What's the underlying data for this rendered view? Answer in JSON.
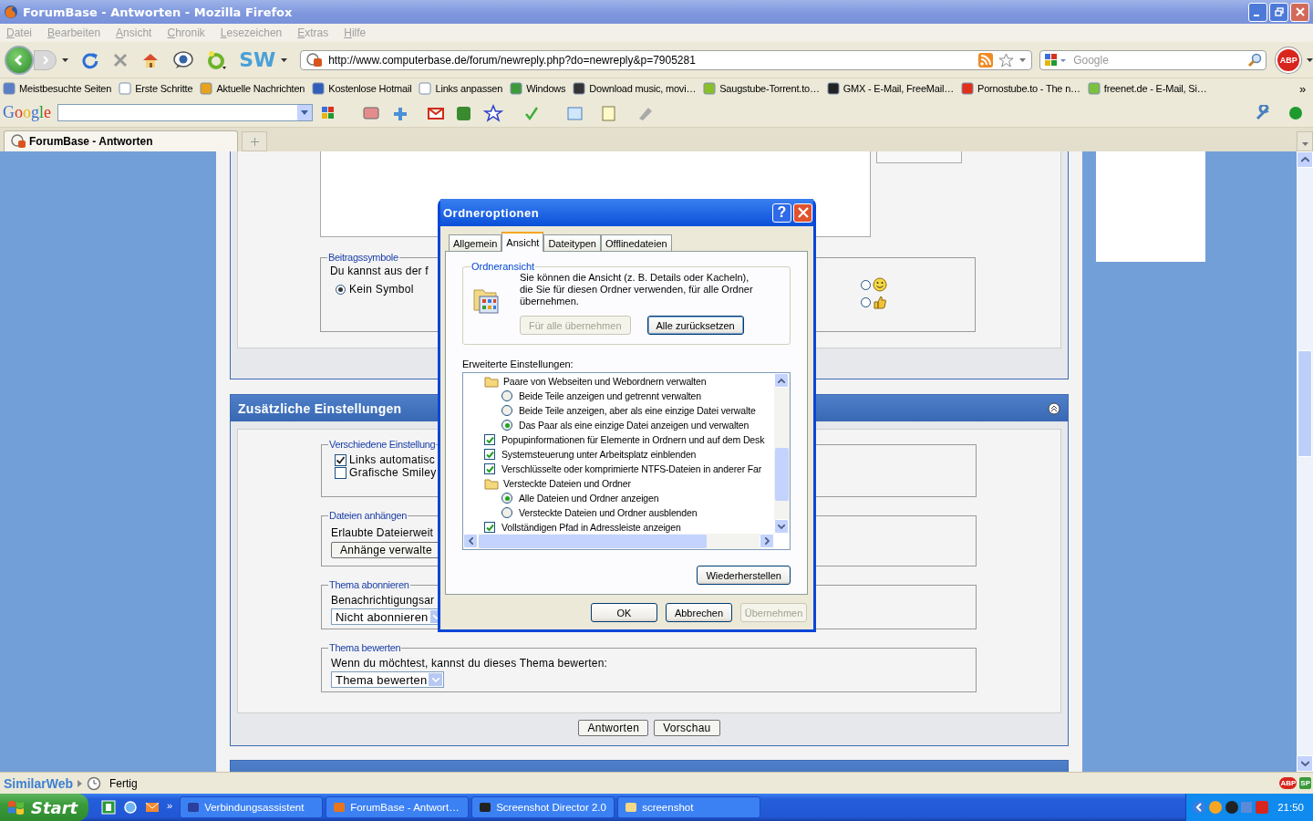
{
  "window": {
    "title": "ForumBase - Antworten - Mozilla Firefox"
  },
  "menu": [
    "Datei",
    "Bearbeiten",
    "Ansicht",
    "Chronik",
    "Lesezeichen",
    "Extras",
    "Hilfe"
  ],
  "toolbar": {
    "sw": "SW",
    "abp": "ABP"
  },
  "address_bar": {
    "value": "http://www.computerbase.de/forum/newreply.php?do=newreply&p=7905281"
  },
  "search": {
    "placeholder": "Google"
  },
  "bookmarks": [
    "Meistbesuchte Seiten",
    "Erste Schritte",
    "Aktuelle Nachrichten",
    "Kostenlose Hotmail",
    "Links anpassen",
    "Windows",
    "Download music, movi…",
    "Saugstube-Torrent.to…",
    "GMX - E-Mail, FreeMail…",
    "Pornostube.to - The n…",
    "freenet.de - E-Mail, Si…"
  ],
  "bookmarks_more": "»",
  "google_toolbar": {
    "logo": "Google"
  },
  "tabs": [
    {
      "label": "ForumBase - Antworten",
      "selected": true
    }
  ],
  "page": {
    "post_icons": {
      "legend": "Beitragssymbole",
      "intro": "Du kannst aus der f",
      "options": [
        {
          "label": "Kein Symbol",
          "selected": true
        },
        {
          "selected": false
        },
        {
          "selected": false
        }
      ]
    },
    "additional": {
      "title": "Zusätzliche Einstellungen",
      "sections": [
        {
          "legend": "Verschiedene Einstellung",
          "kind": "checkboxes",
          "items": [
            {
              "label": "Links automatisc",
              "checked": true
            },
            {
              "label": "Grafische Smiley",
              "checked": false
            }
          ]
        },
        {
          "legend": "Dateien anhängen",
          "kind": "button",
          "text": "Erlaubte Dateierweit",
          "button": "Anhänge verwalte"
        },
        {
          "legend": "Thema abonnieren",
          "kind": "select",
          "text": "Benachrichtigungsar",
          "value": "Nicht abonnieren"
        },
        {
          "legend": "Thema bewerten",
          "kind": "select",
          "text": "Wenn du möchtest, kannst du dieses Thema bewerten:",
          "value": "Thema bewerten"
        }
      ]
    },
    "buttons": [
      "Antworten",
      "Vorschau"
    ]
  },
  "dialog": {
    "title": "Ordneroptionen",
    "help": "?",
    "tabs": [
      {
        "label": "Allgemein",
        "selected": false
      },
      {
        "label": "Ansicht",
        "selected": true
      },
      {
        "label": "Dateitypen",
        "selected": false
      },
      {
        "label": "Offlinedateien",
        "selected": false
      }
    ],
    "folder_view": {
      "legend": "Ordneransicht",
      "description": "Sie können die Ansicht (z. B. Details oder Kacheln), die Sie für diesen Ordner verwenden, für alle Ordner übernehmen.",
      "buttons": [
        {
          "label": "Für alle übernehmen",
          "disabled": true
        },
        {
          "label": "Alle zurücksetzen",
          "disabled": false
        }
      ]
    },
    "advanced_label": "Erweiterte Einstellungen:",
    "advanced": [
      {
        "kind": "folder",
        "label": "Paare von Webseiten und Webordnern verwalten",
        "children": [
          {
            "kind": "radio",
            "label": "Beide Teile anzeigen und getrennt verwalten",
            "selected": false
          },
          {
            "kind": "radio",
            "label": "Beide Teile anzeigen, aber als eine einzige Datei verwalte",
            "selected": false
          },
          {
            "kind": "radio",
            "label": "Das Paar als eine einzige Datei anzeigen und verwalten",
            "selected": true
          }
        ]
      },
      {
        "kind": "checkbox",
        "label": "Popupinformationen für Elemente in Ordnern und auf dem Desk",
        "checked": true
      },
      {
        "kind": "checkbox",
        "label": "Systemsteuerung unter Arbeitsplatz einblenden",
        "checked": true
      },
      {
        "kind": "checkbox",
        "label": "Verschlüsselte oder komprimierte NTFS-Dateien in anderer Far",
        "checked": true
      },
      {
        "kind": "folder",
        "label": "Versteckte Dateien und Ordner",
        "children": [
          {
            "kind": "radio",
            "label": "Alle Dateien und Ordner anzeigen",
            "selected": true
          },
          {
            "kind": "radio",
            "label": "Versteckte Dateien und Ordner ausblenden",
            "selected": false
          }
        ]
      },
      {
        "kind": "checkbox",
        "label": "Vollständigen Pfad in Adressleiste anzeigen",
        "checked": true
      }
    ],
    "restore_button": "Wiederherstellen",
    "buttons": [
      {
        "label": "OK",
        "disabled": false
      },
      {
        "label": "Abbrechen",
        "disabled": false
      },
      {
        "label": "Übernehmen",
        "disabled": true
      }
    ]
  },
  "status_bar": {
    "brand": "SimilarWeb",
    "text": "Fertig",
    "badges": [
      "ABP",
      "SP"
    ]
  },
  "taskbar": {
    "start": "Start",
    "more": "»",
    "tasks": [
      "Verbindungsassistent",
      "ForumBase - Antwort…",
      "Screenshot Director 2.0",
      "screenshot"
    ],
    "clock": "21:50"
  }
}
